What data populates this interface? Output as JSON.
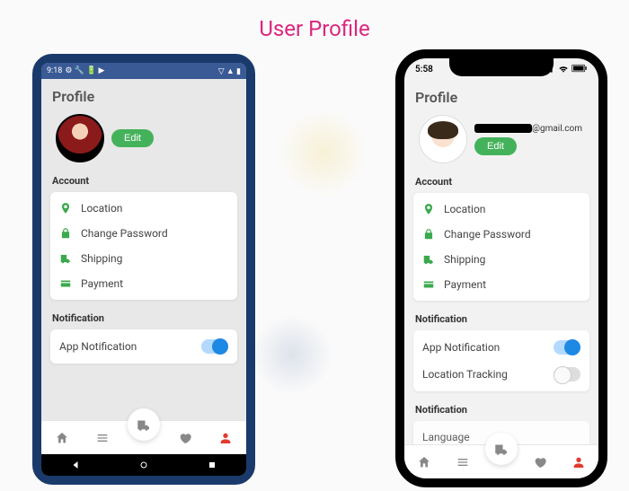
{
  "page": {
    "title": "User Profile"
  },
  "android": {
    "status": {
      "time": "9:18",
      "debug_icons": "⚙ 🔧 🔋 ▶",
      "right_icons": "▽ ▲ ▮"
    },
    "title": "Profile",
    "edit_label": "Edit",
    "sections": {
      "account": {
        "label": "Account",
        "items": [
          {
            "icon": "pin",
            "label": "Location"
          },
          {
            "icon": "lock",
            "label": "Change Password"
          },
          {
            "icon": "truck",
            "label": "Shipping"
          },
          {
            "icon": "card",
            "label": "Payment"
          }
        ]
      },
      "notification": {
        "label": "Notification",
        "items": [
          {
            "label": "App Notification",
            "toggle": true
          }
        ]
      }
    },
    "tabbar": {
      "active_index": 4
    }
  },
  "ios": {
    "status": {
      "time": "5:58"
    },
    "title": "Profile",
    "email_suffix": "@gmail.com",
    "edit_label": "Edit",
    "sections": {
      "account": {
        "label": "Account",
        "items": [
          {
            "icon": "pin",
            "label": "Location"
          },
          {
            "icon": "lock",
            "label": "Change Password"
          },
          {
            "icon": "truck",
            "label": "Shipping"
          },
          {
            "icon": "card",
            "label": "Payment"
          }
        ]
      },
      "notification": {
        "label": "Notification",
        "items": [
          {
            "label": "App Notification",
            "toggle": true
          },
          {
            "label": "Location Tracking",
            "toggle": false
          }
        ]
      },
      "notification2": {
        "label": "Notification",
        "items": [
          {
            "label": "Language"
          }
        ]
      }
    },
    "tabbar": {
      "active_index": 4
    }
  }
}
